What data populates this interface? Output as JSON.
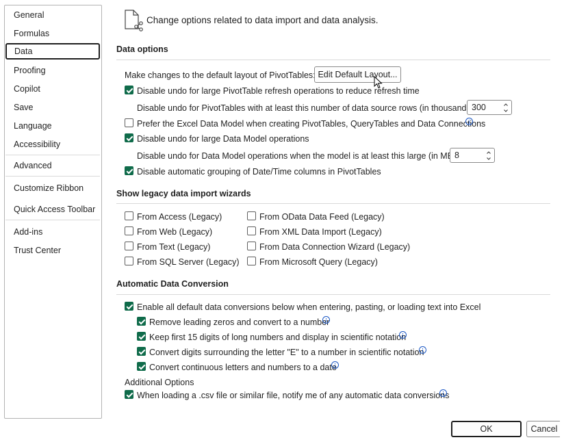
{
  "sidebar": {
    "items": [
      {
        "label": "General"
      },
      {
        "label": "Formulas"
      },
      {
        "label": "Data"
      },
      {
        "label": "Proofing"
      },
      {
        "label": "Copilot"
      },
      {
        "label": "Save"
      },
      {
        "label": "Language"
      },
      {
        "label": "Accessibility"
      },
      {
        "label": "Advanced"
      },
      {
        "label": "Customize Ribbon"
      },
      {
        "label": "Quick Access Toolbar"
      },
      {
        "label": "Add-ins"
      },
      {
        "label": "Trust Center"
      }
    ],
    "selected": "Data"
  },
  "header": {
    "icon": "document-data-icon",
    "description": "Change options related to data import and data analysis."
  },
  "data_options": {
    "title": "Data options",
    "default_layout_label": "Make changes to the default layout of PivotTables:",
    "edit_default_layout_button": "Edit Default Layout...",
    "disable_undo_refresh": {
      "label": "Disable undo for large PivotTable refresh operations to reduce refresh time",
      "checked": true
    },
    "rows_threshold_label": "Disable undo for PivotTables with at least this number of data source rows (in thousands):",
    "rows_threshold_value": "300",
    "prefer_data_model": {
      "label": "Prefer the Excel Data Model when creating PivotTables, QueryTables and Data Connections",
      "checked": false
    },
    "disable_undo_data_model": {
      "label": "Disable undo for large Data Model operations",
      "checked": true
    },
    "model_size_label": "Disable undo for Data Model operations when the model is at least this large (in MB):",
    "model_size_value": "8",
    "disable_auto_grouping": {
      "label": "Disable automatic grouping of Date/Time columns in PivotTables",
      "checked": true
    }
  },
  "legacy_wizards": {
    "title": "Show legacy data import wizards",
    "left": [
      {
        "label": "From Access (Legacy)",
        "checked": false
      },
      {
        "label": "From Web (Legacy)",
        "checked": false
      },
      {
        "label": "From Text (Legacy)",
        "checked": false
      },
      {
        "label": "From SQL Server (Legacy)",
        "checked": false
      }
    ],
    "right": [
      {
        "label": "From OData Data Feed (Legacy)",
        "checked": false
      },
      {
        "label": "From XML Data Import (Legacy)",
        "checked": false
      },
      {
        "label": "From Data Connection Wizard (Legacy)",
        "checked": false
      },
      {
        "label": "From Microsoft Query (Legacy)",
        "checked": false
      }
    ]
  },
  "auto_conversion": {
    "title": "Automatic Data Conversion",
    "enable_all": {
      "label": "Enable all default data conversions below when entering, pasting, or loading text into Excel",
      "checked": true
    },
    "remove_zeros": {
      "label": "Remove leading zeros and convert to a number",
      "checked": true
    },
    "keep_15_digits": {
      "label": "Keep first 15 digits of long numbers and display in scientific notation",
      "checked": true
    },
    "convert_e": {
      "label": "Convert digits surrounding the letter \"E\" to a number in scientific notation",
      "checked": true
    },
    "convert_dates": {
      "label": "Convert continuous letters and numbers to a date",
      "checked": true
    },
    "additional_title": "Additional Options",
    "notify_csv": {
      "label": "When loading a .csv file or similar file, notify me of any automatic data conversions",
      "checked": true
    }
  },
  "footer": {
    "ok": "OK",
    "cancel": "Cancel"
  },
  "colors": {
    "checkbox_checked": "#0f6b4a",
    "info_icon": "#1a57c4"
  }
}
